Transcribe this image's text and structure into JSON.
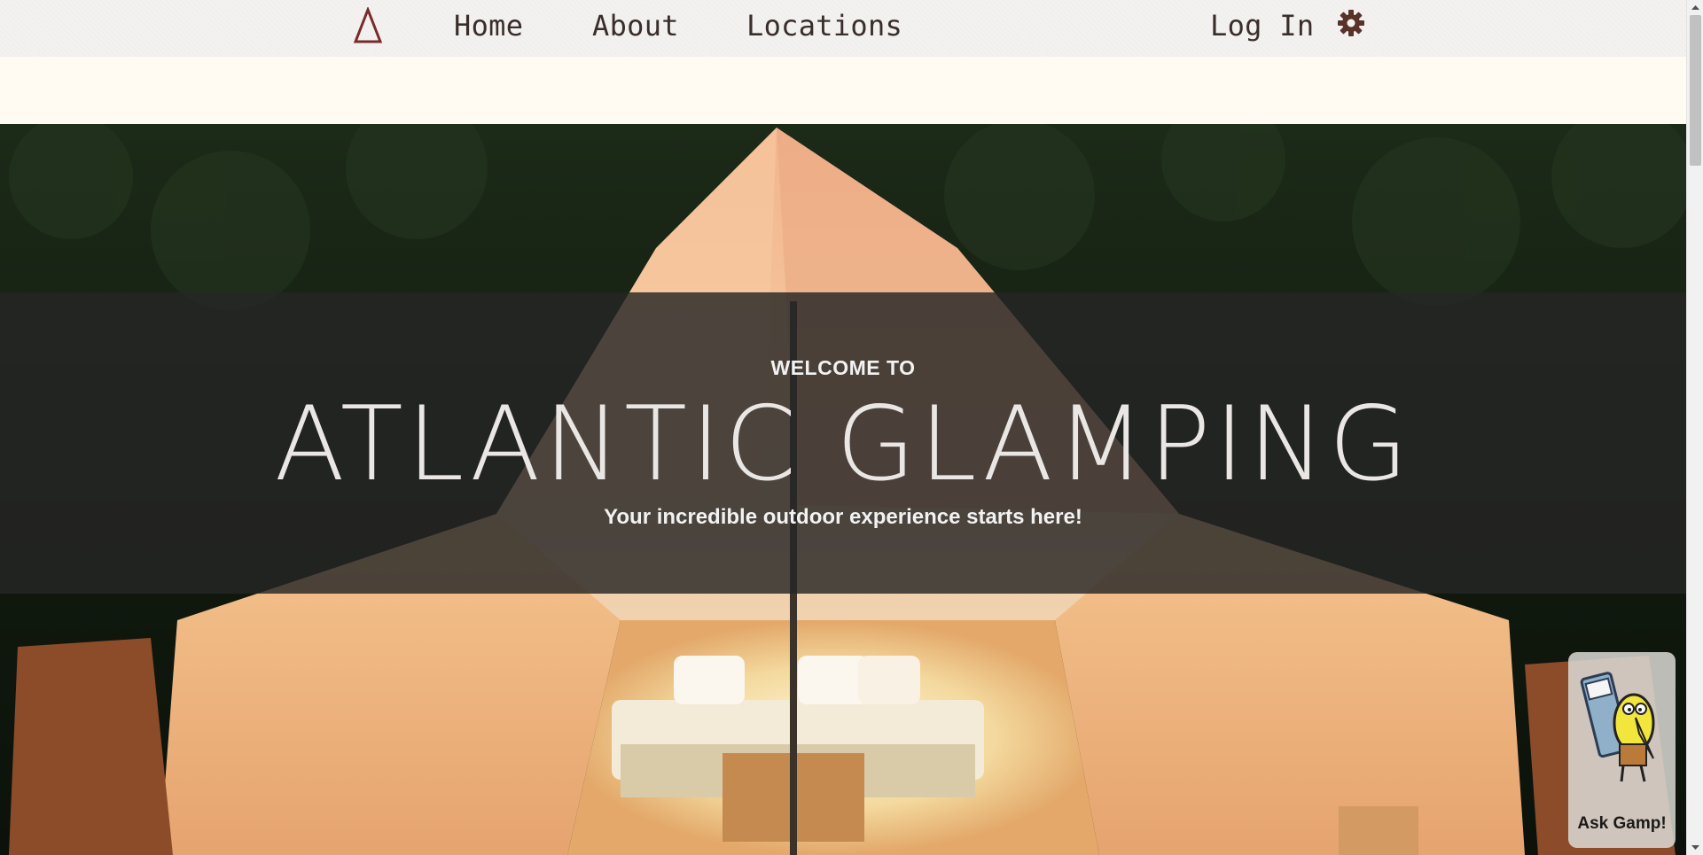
{
  "nav": {
    "logo_icon": "triangle-tent-logo",
    "home": "Home",
    "about": "About",
    "locations": "Locations",
    "login": "Log In",
    "settings_icon": "gear-icon"
  },
  "hero": {
    "welcome": "WELCOME TO",
    "brand": "ATLANTIC GLAMPING",
    "tagline": "Your incredible outdoor experience starts here!"
  },
  "assistant": {
    "label": "Ask Gamp!"
  },
  "colors": {
    "nav_bg": "#f3f2f1",
    "nav_text": "#3a2e2a",
    "logo": "#7a2a2a",
    "gear": "#5a3328",
    "cream": "#fffbf2",
    "banner": "#262626"
  }
}
